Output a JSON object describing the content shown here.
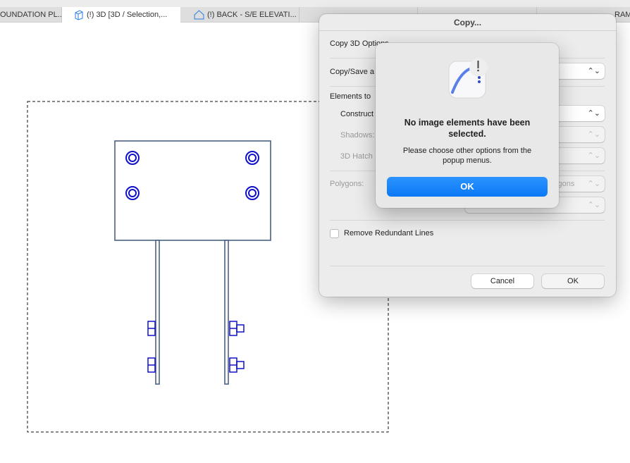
{
  "tabs": [
    {
      "label": "OUNDATION PL...",
      "icon": "plan-icon",
      "active": false
    },
    {
      "label": "(!) 3D [3D / Selection,...",
      "icon": "3d-box-icon",
      "active": true
    },
    {
      "label": "(!) BACK - S/E ELEVATI...",
      "icon": "elevation-house-icon",
      "active": false
    },
    {
      "label": "RAM",
      "icon": "window-icon",
      "active": false
    }
  ],
  "dialog": {
    "title": "Copy...",
    "section_options": "Copy 3D Options",
    "copy_save_label": "Copy/Save a",
    "elements_label": "Elements to",
    "construct_label": "Construct",
    "shadows_label": "Shadows:",
    "hatch_label": "3D Hatch",
    "polygons_label": "Polygons:",
    "polygons_value": "ygons",
    "remove_redundant_label": "Remove Redundant Lines",
    "remove_redundant_checked": false,
    "cancel_label": "Cancel",
    "ok_label": "OK"
  },
  "alert": {
    "title": "No image elements have been selected.",
    "message": "Please choose other options from the popup menus.",
    "ok_label": "OK"
  },
  "colors": {
    "accent": "#0a78f5",
    "drawing_line": "#4a6183",
    "bolt": "#1010c8"
  }
}
